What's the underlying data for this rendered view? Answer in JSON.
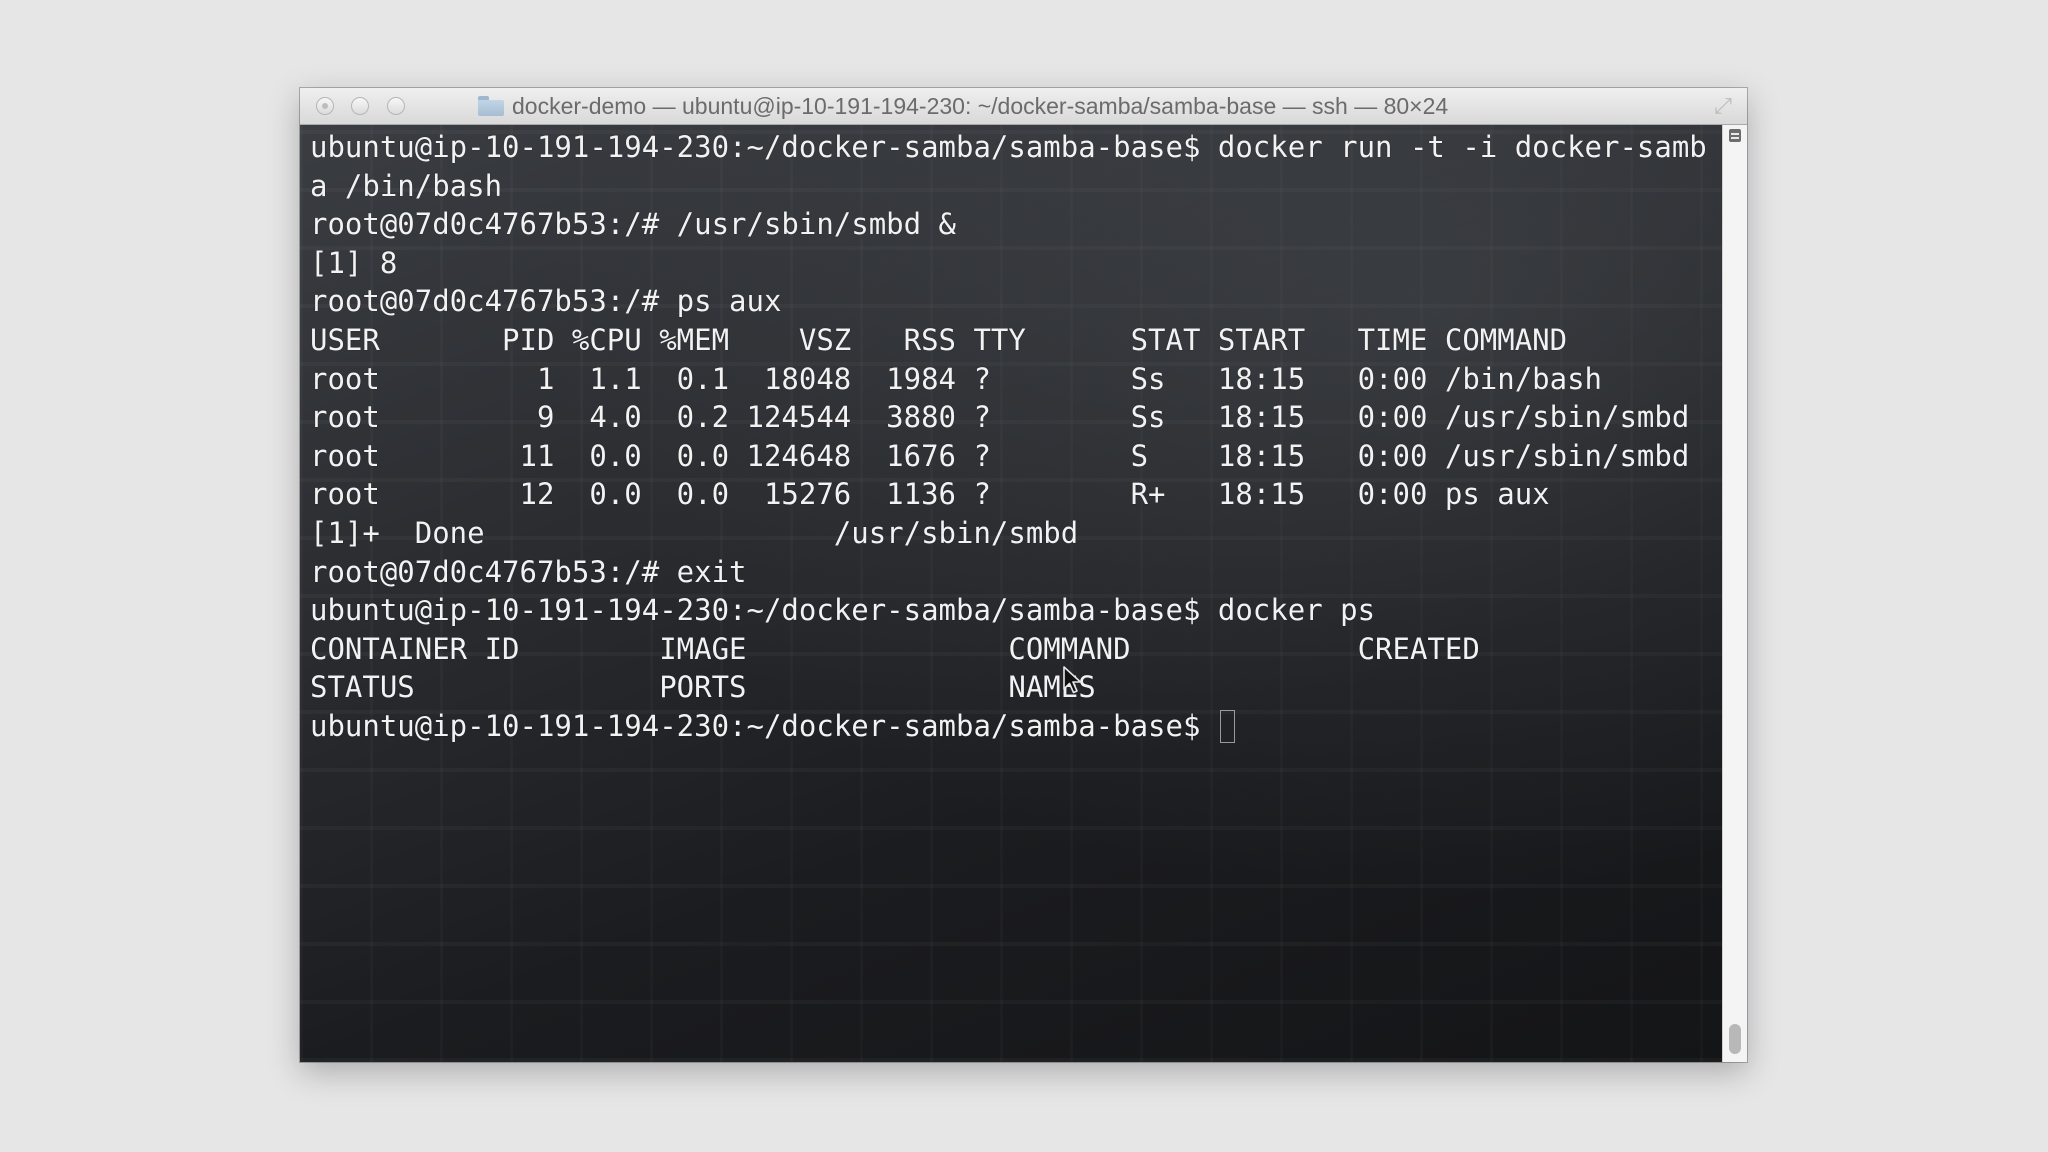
{
  "window": {
    "title": "docker-demo — ubuntu@ip-10-191-194-230: ~/docker-samba/samba-base — ssh — 80×24",
    "titlebar_icon": "folder-icon",
    "fullscreen_icon": "fullscreen-arrows-icon"
  },
  "terminal": {
    "lines": [
      "ubuntu@ip-10-191-194-230:~/docker-samba/samba-base$ docker run -t -i docker-samb",
      "a /bin/bash",
      "root@07d0c4767b53:/# /usr/sbin/smbd &",
      "[1] 8",
      "root@07d0c4767b53:/# ps aux",
      "USER       PID %CPU %MEM    VSZ   RSS TTY      STAT START   TIME COMMAND",
      "root         1  1.1  0.1  18048  1984 ?        Ss   18:15   0:00 /bin/bash",
      "root         9  4.0  0.2 124544  3880 ?        Ss   18:15   0:00 /usr/sbin/smbd",
      "root        11  0.0  0.0 124648  1676 ?        S    18:15   0:00 /usr/sbin/smbd",
      "root        12  0.0  0.0  15276  1136 ?        R+   18:15   0:00 ps aux",
      "[1]+  Done                    /usr/sbin/smbd",
      "root@07d0c4767b53:/# exit",
      "ubuntu@ip-10-191-194-230:~/docker-samba/samba-base$ docker ps",
      "CONTAINER ID        IMAGE               COMMAND             CREATED",
      "STATUS              PORTS               NAMES",
      "ubuntu@ip-10-191-194-230:~/docker-samba/samba-base$ "
    ]
  },
  "colors": {
    "terminal_text": "#f2f2f2",
    "page_background": "#e6e6e7"
  }
}
